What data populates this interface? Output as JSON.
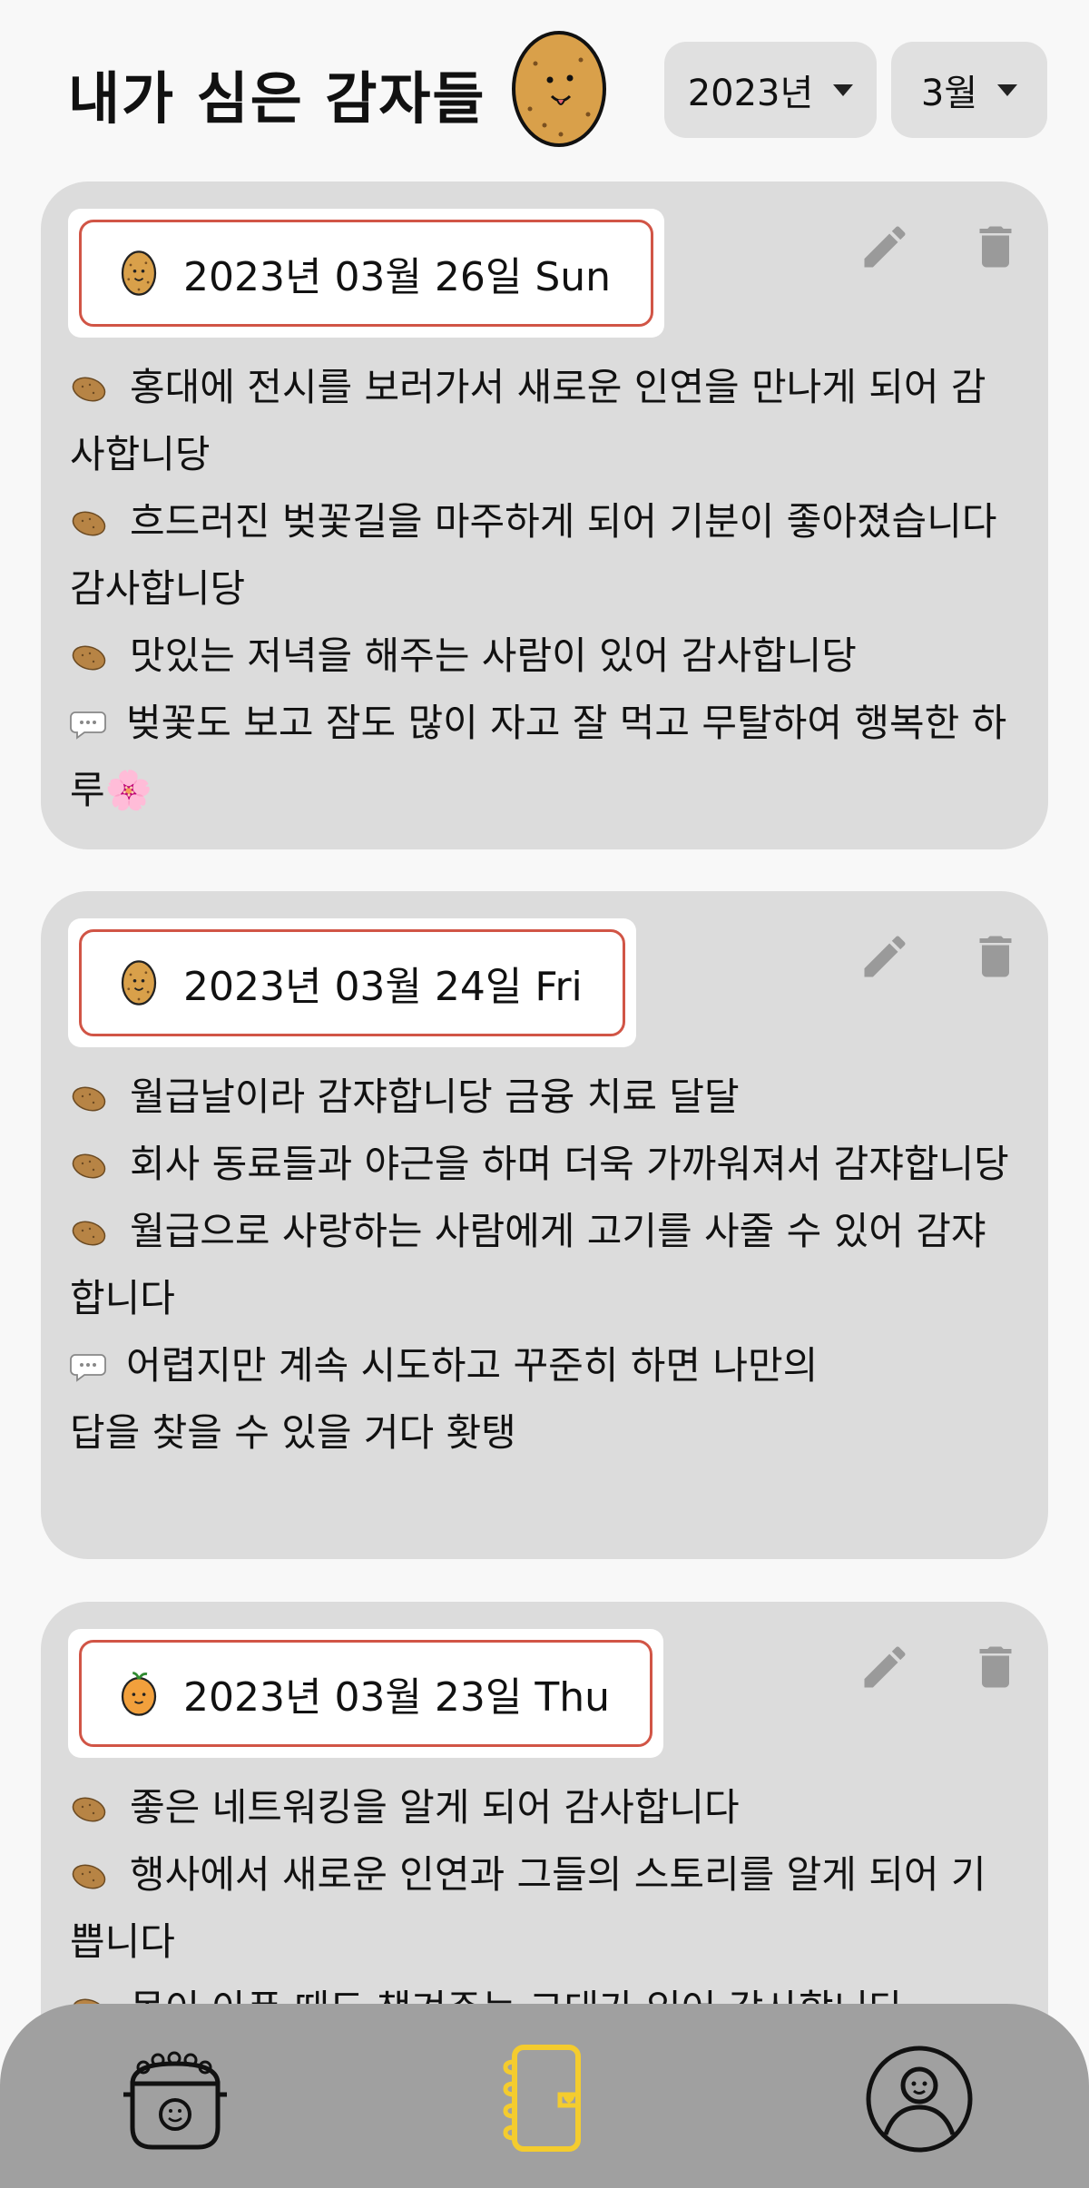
{
  "header": {
    "title": "내가 심은 감자들",
    "year_select": "2023년",
    "month_select": "3월"
  },
  "cards": [
    {
      "date": "2023년 03월 26일 Sun",
      "chip_icon": "potato-icon",
      "entries": [
        {
          "type": "potato",
          "text": "홍대에 전시를 보러가서 새로운 인연을 만나게 되어 감사합니당"
        },
        {
          "type": "potato",
          "text": "흐드러진 벚꽃길을 마주하게 되어 기분이 좋아졌습니다 감사합니당"
        },
        {
          "type": "potato",
          "text": "맛있는 저녁을 해주는 사람이 있어 감사합니당"
        },
        {
          "type": "comment",
          "text": "벚꽃도 보고 잠도 많이 자고 잘 먹고 무탈하여 행복한 하루🌸"
        }
      ]
    },
    {
      "date": "2023년 03월 24일 Fri",
      "chip_icon": "potato-icon",
      "entries": [
        {
          "type": "potato",
          "text": "월급날이라 감쟈합니당 금융 치료 달달"
        },
        {
          "type": "potato",
          "text": "회사 동료들과 야근을 하며 더욱 가까워져서 감쟈합니당"
        },
        {
          "type": "potato",
          "text": "월급으로 사랑하는 사람에게 고기를 사줄 수 있어 감쟈합니다"
        },
        {
          "type": "comment",
          "text": "어렵지만 계속 시도하고 꾸준히 하면 나만의"
        },
        {
          "type": "plain",
          "text": "답을 찾을 수 있을 거다 홧탱"
        }
      ]
    },
    {
      "date": "2023년 03월 23일 Thu",
      "chip_icon": "tangerine-icon",
      "entries": [
        {
          "type": "potato",
          "text": "좋은 네트워킹을 알게 되어 감사합니다"
        },
        {
          "type": "potato",
          "text": "행사에서 새로운 인연과 그들의 스토리를 알게 되어 기쁩니다"
        },
        {
          "type": "potato",
          "text": "몸이 아픈 때도 챙겨주는 그대가 있어 감사합니다"
        }
      ]
    }
  ],
  "bottom_nav": {
    "items": [
      "rice-pot-icon",
      "diary-icon",
      "profile-icon"
    ],
    "active": "diary-icon"
  },
  "colors": {
    "card_bg": "#dcdcdc",
    "chip_border": "#d15546",
    "potato": "#d9a04a",
    "active_nav": "#f4cc2e",
    "nav_bg": "#a0a0a0"
  }
}
